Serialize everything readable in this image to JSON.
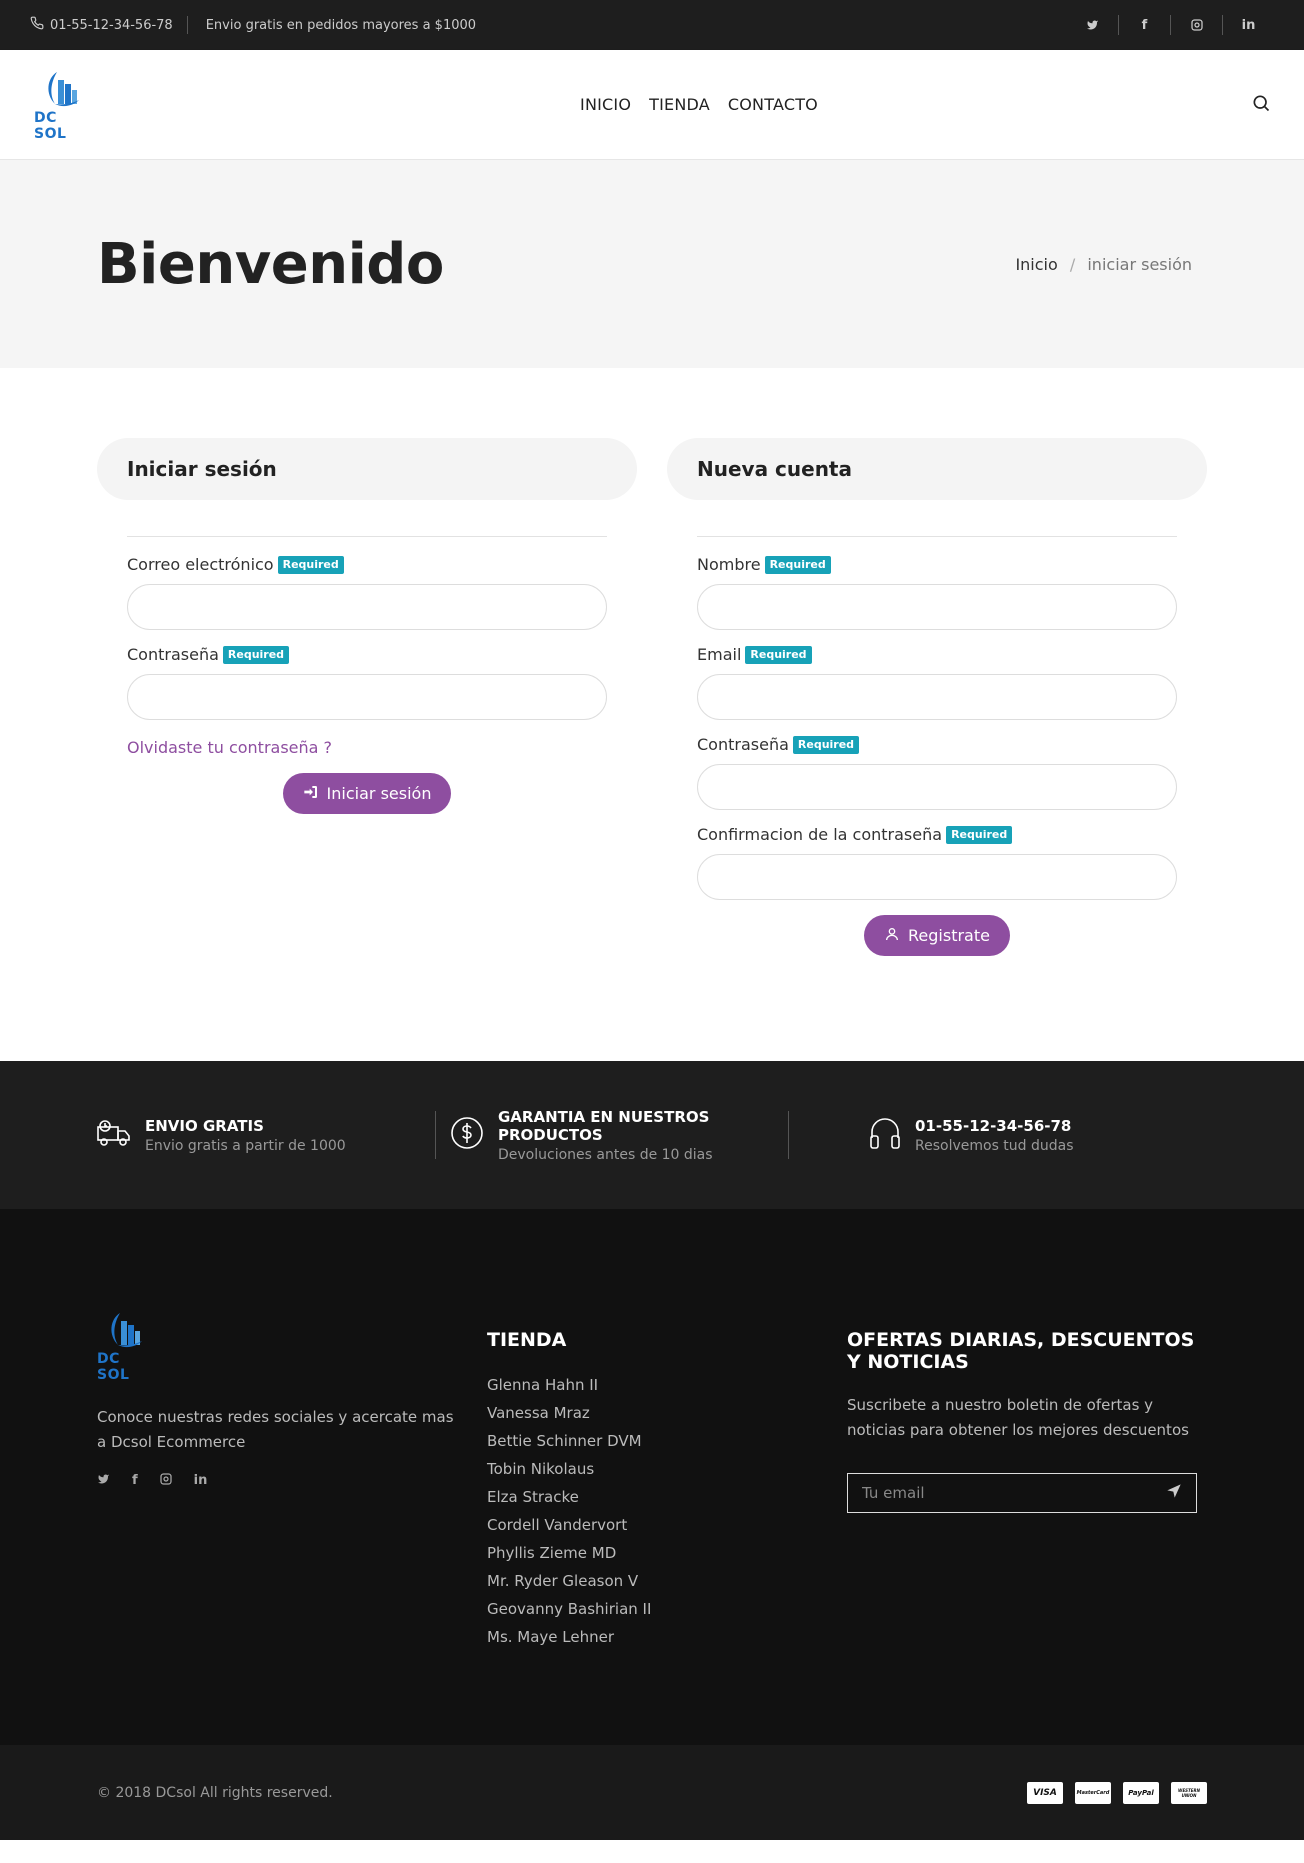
{
  "topbar": {
    "phone": "01-55-12-34-56-78",
    "promo": "Envio gratis en pedidos mayores a $1000",
    "social": [
      "twitter-icon",
      "facebook-icon",
      "instagram-icon",
      "linkedin-icon"
    ]
  },
  "header": {
    "logo_text": "DC SOL",
    "nav": [
      "INICIO",
      "TIENDA",
      "CONTACTO"
    ]
  },
  "page_title": {
    "title": "Bienvenido",
    "breadcrumb": {
      "home": "Inicio",
      "separator": "/",
      "current": "iniciar sesión"
    }
  },
  "login": {
    "heading": "Iniciar sesión",
    "email_label": "Correo electrónico",
    "password_label": "Contraseña",
    "required_badge": "Required",
    "forgot": "Olvidaste tu contraseña ?",
    "submit": "Iniciar sesión"
  },
  "register": {
    "heading": "Nueva cuenta",
    "name_label": "Nombre",
    "email_label": "Email",
    "password_label": "Contraseña",
    "confirm_label": "Confirmacion de la contraseña",
    "required_badge": "Required",
    "submit": "Registrate"
  },
  "features": [
    {
      "title": "ENVIO GRATIS",
      "subtitle": "Envio gratis a partir de 1000"
    },
    {
      "title": "GARANTIA EN NUESTROS PRODUCTOS",
      "subtitle": "Devoluciones antes de 10 dias"
    },
    {
      "title": "01-55-12-34-56-78",
      "subtitle": "Resolvemos tud dudas"
    }
  ],
  "footer": {
    "logo_text": "DC SOL",
    "about": "Conoce nuestras redes sociales y acercate mas a Dcsol Ecommerce",
    "shop_title": "TIENDA",
    "shop_items": [
      "Glenna Hahn II",
      "Vanessa Mraz",
      "Bettie Schinner DVM",
      "Tobin Nikolaus",
      "Elza Stracke",
      "Cordell Vandervort",
      "Phyllis Zieme MD",
      "Mr. Ryder Gleason V",
      "Geovanny Bashirian II",
      "Ms. Maye Lehner"
    ],
    "newsletter_title": "OFERTAS DIARIAS, DESCUENTOS Y NOTICIAS",
    "newsletter_text": "Suscribete a nuestro boletin de ofertas y noticias para obtener los mejores descuentos",
    "newsletter_placeholder": "Tu email",
    "copyright": "© 2018 DCsol All rights reserved.",
    "payments": [
      "VISA",
      "MasterCard",
      "PayPal",
      "WESTERN UNION"
    ]
  },
  "colors": {
    "accent": "#8e4ea0",
    "badge": "#17a2b8",
    "brand": "#1f74c8"
  }
}
